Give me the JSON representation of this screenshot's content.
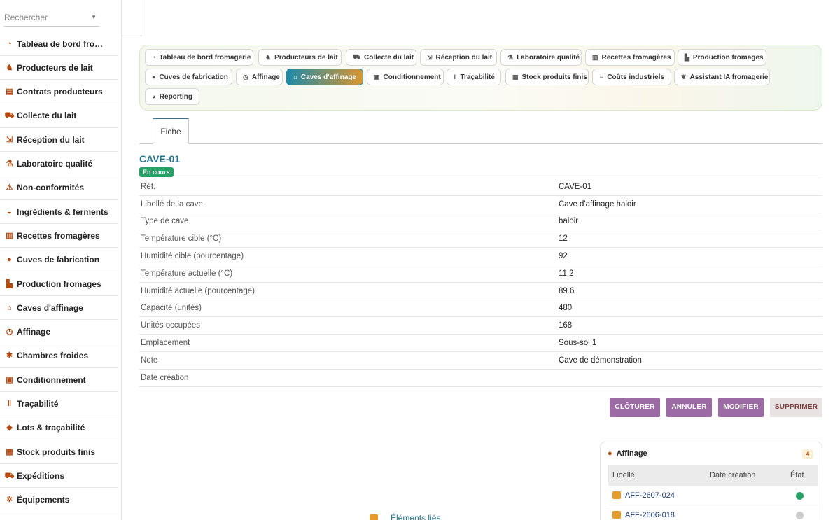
{
  "search": {
    "placeholder": "Rechercher"
  },
  "sidebar": {
    "items": [
      {
        "label": "Tableau de bord fro…",
        "icon": "dashboard-icon"
      },
      {
        "label": "Producteurs de lait",
        "icon": "cows-icon"
      },
      {
        "label": "Contrats producteurs",
        "icon": "contract-icon"
      },
      {
        "label": "Collecte du lait",
        "icon": "truck-icon"
      },
      {
        "label": "Réception du lait",
        "icon": "trolley-icon"
      },
      {
        "label": "Laboratoire qualité",
        "icon": "microscope-icon"
      },
      {
        "label": "Non-conformités",
        "icon": "warning-icon"
      },
      {
        "label": "Ingrédients & ferments",
        "icon": "mortar-icon"
      },
      {
        "label": "Recettes fromagères",
        "icon": "book-icon"
      },
      {
        "label": "Cuves de fabrication",
        "icon": "drop-icon"
      },
      {
        "label": "Production fromages",
        "icon": "factory-icon"
      },
      {
        "label": "Caves d'affinage",
        "icon": "warehouse-icon"
      },
      {
        "label": "Affinage",
        "icon": "clock-icon"
      },
      {
        "label": "Chambres froides",
        "icon": "snowflake-icon"
      },
      {
        "label": "Conditionnement",
        "icon": "box-icon"
      },
      {
        "label": "Traçabilité",
        "icon": "barcode-icon"
      },
      {
        "label": "Lots & traçabilité",
        "icon": "tags-icon"
      },
      {
        "label": "Stock produits finis",
        "icon": "boxes-icon"
      },
      {
        "label": "Expéditions",
        "icon": "shipping-icon"
      },
      {
        "label": "Équipements",
        "icon": "gears-icon"
      }
    ]
  },
  "topnav": {
    "items": [
      {
        "label": "Tableau de bord fromagerie",
        "icon": "dashboard-icon"
      },
      {
        "label": "Producteurs de lait",
        "icon": "cows-icon"
      },
      {
        "label": "Collecte du lait",
        "icon": "truck-icon"
      },
      {
        "label": "Réception du lait",
        "icon": "trolley-icon"
      },
      {
        "label": "Laboratoire qualité",
        "icon": "microscope-icon"
      },
      {
        "label": "Recettes fromagères",
        "icon": "book-icon"
      },
      {
        "label": "Production fromages",
        "icon": "factory-icon"
      },
      {
        "label": "Cuves de fabrication",
        "icon": "drop-icon"
      },
      {
        "label": "Affinage",
        "icon": "clock-icon"
      },
      {
        "label": "Caves d'affinage",
        "icon": "warehouse-icon",
        "active": true
      },
      {
        "label": "Conditionnement",
        "icon": "box-icon"
      },
      {
        "label": "Traçabilité",
        "icon": "barcode-icon"
      },
      {
        "label": "Stock produits finis",
        "icon": "boxes-icon"
      },
      {
        "label": "Coûts industriels",
        "icon": "coins-icon"
      },
      {
        "label": "Assistant IA fromagerie",
        "icon": "brain-icon"
      },
      {
        "label": "Reporting",
        "icon": "pie-icon"
      }
    ]
  },
  "tabs": {
    "fiche": "Fiche"
  },
  "record": {
    "title": "CAVE-01",
    "status": "En cours",
    "status_color": "#26a267",
    "fields": [
      {
        "label": "Réf.",
        "value": "CAVE-01"
      },
      {
        "label": "Libellé de la cave",
        "value": "Cave d'affinage haloir"
      },
      {
        "label": "Type de cave",
        "value": "haloir"
      },
      {
        "label": "Température cible (°C)",
        "value": "12"
      },
      {
        "label": "Humidité cible (pourcentage)",
        "value": "92"
      },
      {
        "label": "Température actuelle (°C)",
        "value": "11.2"
      },
      {
        "label": "Humidité actuelle (pourcentage)",
        "value": "89.6"
      },
      {
        "label": "Capacité (unités)",
        "value": "480"
      },
      {
        "label": "Unités occupées",
        "value": "168"
      },
      {
        "label": "Emplacement",
        "value": "Sous-sol 1"
      },
      {
        "label": "Note",
        "value": "Cave de démonstration."
      },
      {
        "label": "Date création",
        "value": ""
      }
    ]
  },
  "actions": {
    "cloturer": "CLÔTURER",
    "annuler": "ANNULER",
    "modifier": "MODIFIER",
    "supprimer": "SUPPRIMER"
  },
  "linked": {
    "title": "Affinage",
    "count": "4",
    "columns": [
      "Libellé",
      "Date création",
      "État"
    ],
    "rows": [
      {
        "label": "AFF-2607-024",
        "state_color": "#26a267"
      },
      {
        "label": "AFF-2606-018",
        "state_color": "#cccccc"
      }
    ]
  },
  "related": {
    "title": "Éléments liés"
  },
  "colors": {
    "accent": "#27778f",
    "brand_orange": "#b5480c",
    "button_purple": "#9c6aa4"
  }
}
